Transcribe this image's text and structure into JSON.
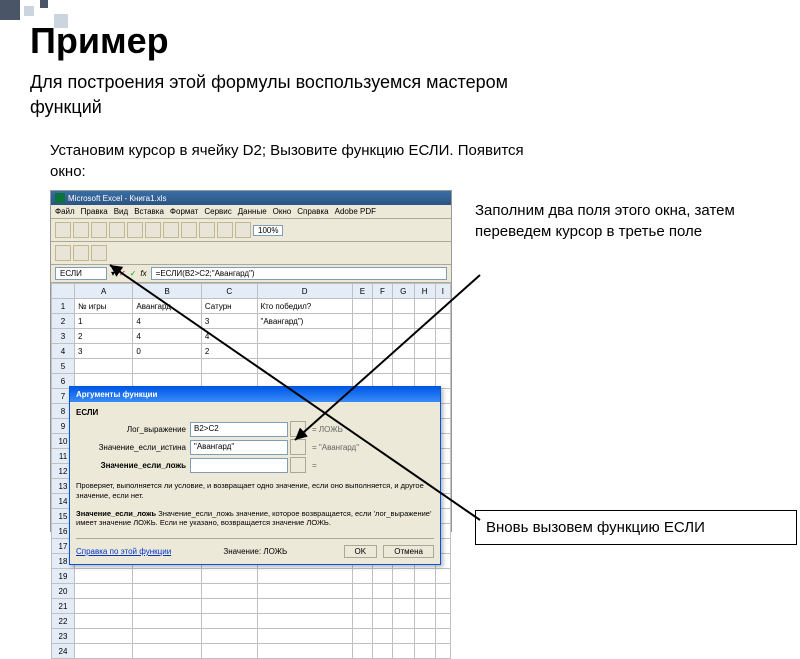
{
  "title": "Пример",
  "subtitle": "Для построения этой формулы воспользуемся мастером функций",
  "step": "Установим курсор в ячейку D2; Вызовите функцию ЕСЛИ. Появится окно:",
  "note1": "Заполним два поля этого окна, затем переведем курсор в третье поле",
  "note2": "Вновь вызовем функцию ЕСЛИ",
  "excel": {
    "titlebar": "Microsoft Excel - Книга1.xls",
    "menu": [
      "Файл",
      "Правка",
      "Вид",
      "Вставка",
      "Формат",
      "Сервис",
      "Данные",
      "Окно",
      "Справка",
      "Adobe PDF"
    ],
    "zoom": "100%",
    "namebox": "ЕСЛИ",
    "formula": "=ЕСЛИ(B2>C2;\"Авангард\")",
    "cols": [
      "A",
      "B",
      "C",
      "D",
      "E",
      "F",
      "G",
      "H",
      "I"
    ],
    "rows": [
      "1",
      "2",
      "3",
      "4",
      "5",
      "6",
      "7",
      "8",
      "9",
      "10",
      "11",
      "12",
      "13",
      "14",
      "15",
      "16",
      "17",
      "18",
      "19",
      "20",
      "21",
      "22",
      "23",
      "24"
    ],
    "data": {
      "A1": "№ игры",
      "B1": "Авангард",
      "C1": "Сатурн",
      "D1": "Кто победил?",
      "A2": "1",
      "B2": "4",
      "C2": "3",
      "D2": "\"Авангард\")",
      "A3": "2",
      "B3": "4",
      "C3": "4",
      "A4": "3",
      "B4": "0",
      "C4": "2"
    }
  },
  "dialog": {
    "title": "Аргументы функции",
    "fn": "ЕСЛИ",
    "args": [
      {
        "label": "Лог_выражение",
        "value": "B2>C2",
        "result": "= ЛОЖЬ"
      },
      {
        "label": "Значение_если_истина",
        "value": "\"Авангард\"",
        "result": "= \"Авангард\""
      },
      {
        "label": "Значение_если_ложь",
        "value": "",
        "result": "="
      }
    ],
    "desc1": "Проверяет, выполняется ли условие, и возвращает одно значение, если оно выполняется, и другое значение, если нет.",
    "desc2": "Значение_если_ложь  значение, которое возвращается, если 'лог_выражение' имеет значение ЛОЖЬ. Если не указано, возвращается значение ЛОЖЬ.",
    "helpLink": "Справка по этой функции",
    "resultLabel": "Значение: ЛОЖЬ",
    "ok": "OK",
    "cancel": "Отмена"
  }
}
